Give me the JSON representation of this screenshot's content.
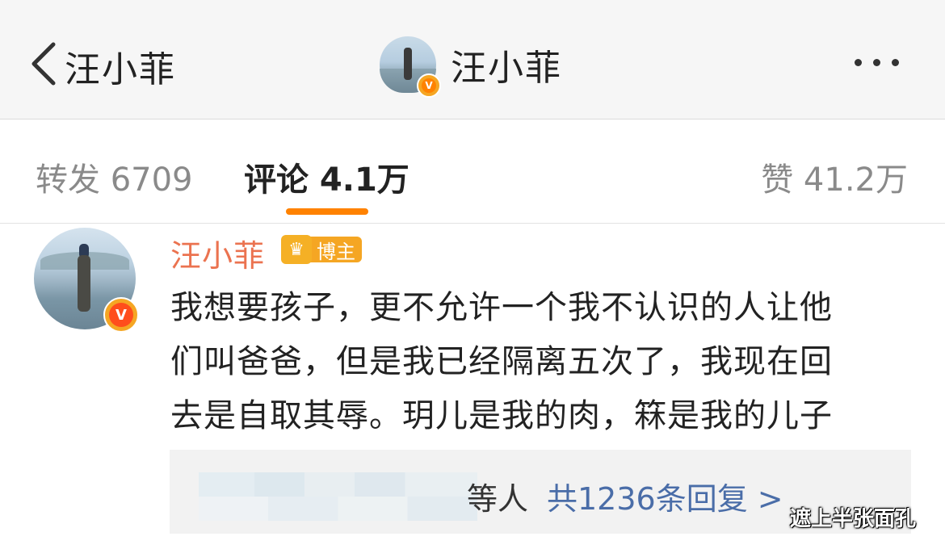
{
  "nav": {
    "back_title": "汪小菲",
    "title": "汪小菲",
    "more_icon": "more-dots-icon",
    "back_icon": "chevron-left-icon"
  },
  "tabs": {
    "repost": "转发 6709",
    "comment": "评论 4.1万",
    "like": "赞 41.2万",
    "active_color": "#ff8200"
  },
  "comment": {
    "user_name": "汪小菲",
    "user_name_color": "#eb7350",
    "badge_label": "博主",
    "verified_icon": "verified-v-icon",
    "text_lines": [
      "我想要孩子，更不允许一个我不认识的人让他",
      "们叫爸爸，但是我已经隔离五次了，我现在回",
      "去是自取其辱。玥儿是我的肉，箖是我的儿子"
    ],
    "reply": {
      "suffix": "等人",
      "count_text": "共1236条回复 >",
      "link_color": "#4a6da8"
    }
  },
  "watermark": "遮上半张面孔"
}
